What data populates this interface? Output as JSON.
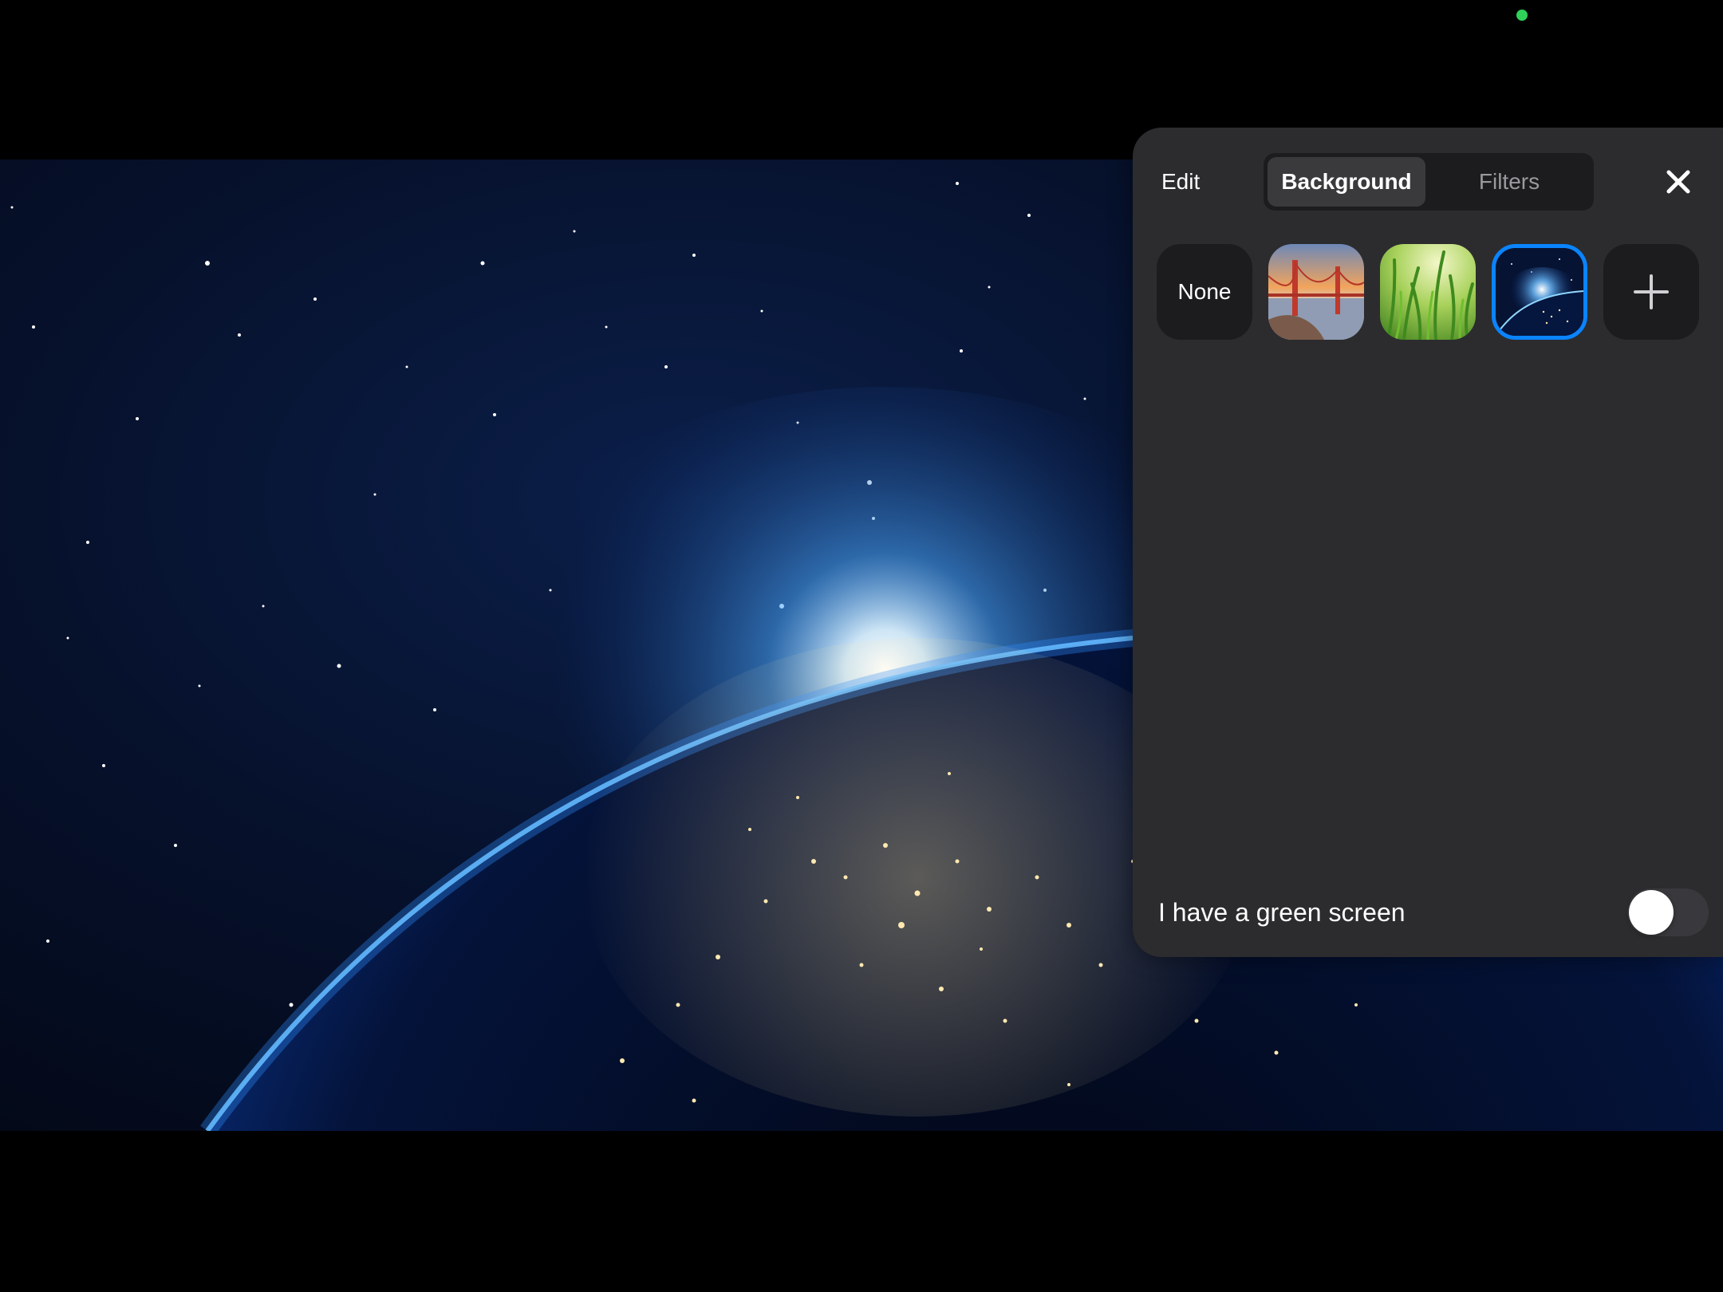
{
  "panel": {
    "edit_label": "Edit",
    "tabs": [
      {
        "label": "Background",
        "selected": true
      },
      {
        "label": "Filters",
        "selected": false
      }
    ],
    "close_icon": "close-icon"
  },
  "backgrounds": {
    "none_label": "None",
    "items": [
      {
        "name": "golden-gate-bridge",
        "selected": false
      },
      {
        "name": "grass",
        "selected": false
      },
      {
        "name": "earth-from-space",
        "selected": true
      }
    ],
    "add_icon": "plus-icon"
  },
  "green_screen": {
    "label": "I have a green screen",
    "enabled": false
  },
  "colors": {
    "accent": "#0a84ff",
    "panel_bg": "#2c2c2e",
    "camera_indicator": "#30d158"
  }
}
